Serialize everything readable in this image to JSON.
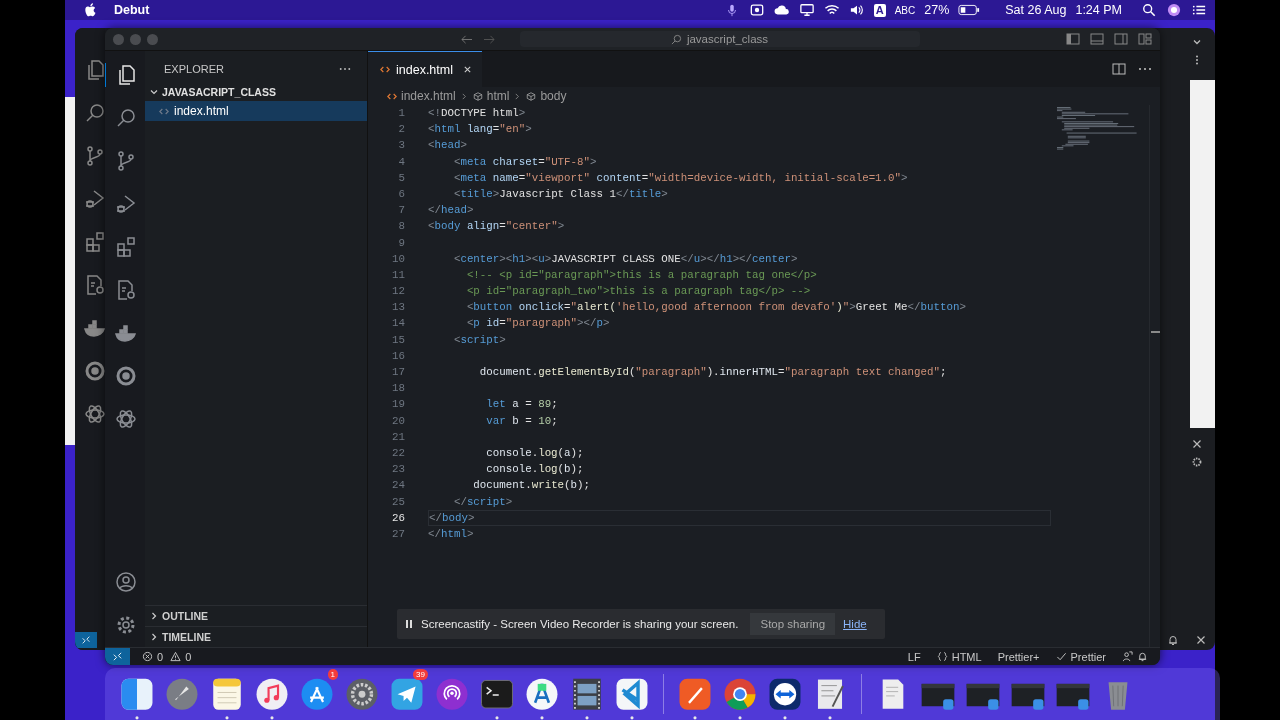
{
  "menubar": {
    "app_name": "Debut",
    "input_badge": "A",
    "input_source": "ABC",
    "battery": "27%",
    "date": "Sat 26 Aug",
    "time": "1:24 PM"
  },
  "editor_window": {
    "title_search": "javascript_class",
    "activity_bar": [
      {
        "kind": "files",
        "selected": true
      },
      {
        "kind": "search",
        "selected": false
      },
      {
        "kind": "branch",
        "selected": false
      },
      {
        "kind": "debug",
        "selected": false
      },
      {
        "kind": "extensions",
        "selected": false
      },
      {
        "kind": "doc-gear",
        "selected": false
      },
      {
        "kind": "docker",
        "selected": false
      },
      {
        "kind": "ring",
        "selected": false
      },
      {
        "kind": "knot",
        "selected": false
      }
    ],
    "activity_bottom": [
      {
        "kind": "account"
      },
      {
        "kind": "gear"
      }
    ],
    "sidebar": {
      "title": "EXPLORER",
      "folder": {
        "name": "JAVASACRIPT_CLASS",
        "expanded": true,
        "files": [
          {
            "name": "index.html",
            "selected": true
          }
        ]
      },
      "sections": [
        {
          "title": "OUTLINE",
          "expanded": false
        },
        {
          "title": "TIMELINE",
          "expanded": false
        }
      ]
    },
    "tabs": [
      {
        "label": "index.html",
        "selected": true
      }
    ],
    "breadcrumbs": [
      {
        "kind": "file",
        "label": "index.html"
      },
      {
        "kind": "element",
        "label": "html"
      },
      {
        "kind": "element",
        "label": "body"
      }
    ],
    "code_lines": [
      {
        "number": "1",
        "current": false,
        "tokens": [
          {
            "kind": "punct",
            "text": "<!"
          },
          {
            "kind": "text",
            "text": "DOCTYPE html"
          },
          {
            "kind": "punct",
            "text": ">"
          }
        ]
      },
      {
        "number": "2",
        "current": false,
        "tokens": [
          {
            "kind": "punct",
            "text": "<"
          },
          {
            "kind": "tag",
            "text": "html"
          },
          {
            "kind": "attr",
            "text": " lang"
          },
          {
            "kind": "text",
            "text": "="
          },
          {
            "kind": "string",
            "text": "\"en\""
          },
          {
            "kind": "punct",
            "text": ">"
          }
        ]
      },
      {
        "number": "3",
        "current": false,
        "tokens": [
          {
            "kind": "punct",
            "text": "<"
          },
          {
            "kind": "tag",
            "text": "head"
          },
          {
            "kind": "punct",
            "text": ">"
          }
        ]
      },
      {
        "number": "4",
        "current": false,
        "tokens": [
          {
            "kind": "punct",
            "text": "    <"
          },
          {
            "kind": "tag",
            "text": "meta"
          },
          {
            "kind": "attr",
            "text": " charset"
          },
          {
            "kind": "text",
            "text": "="
          },
          {
            "kind": "string",
            "text": "\"UTF-8\""
          },
          {
            "kind": "punct",
            "text": ">"
          }
        ]
      },
      {
        "number": "5",
        "current": false,
        "tokens": [
          {
            "kind": "punct",
            "text": "    <"
          },
          {
            "kind": "tag",
            "text": "meta"
          },
          {
            "kind": "attr",
            "text": " name"
          },
          {
            "kind": "text",
            "text": "="
          },
          {
            "kind": "string",
            "text": "\"viewport\""
          },
          {
            "kind": "attr",
            "text": " content"
          },
          {
            "kind": "text",
            "text": "="
          },
          {
            "kind": "string",
            "text": "\"width=device-width, initial-scale=1.0\""
          },
          {
            "kind": "punct",
            "text": ">"
          }
        ]
      },
      {
        "number": "6",
        "current": false,
        "tokens": [
          {
            "kind": "punct",
            "text": "    <"
          },
          {
            "kind": "tag",
            "text": "title"
          },
          {
            "kind": "punct",
            "text": ">"
          },
          {
            "kind": "text",
            "text": "Javascript Class 1"
          },
          {
            "kind": "punct",
            "text": "</"
          },
          {
            "kind": "tag",
            "text": "title"
          },
          {
            "kind": "punct",
            "text": ">"
          }
        ]
      },
      {
        "number": "7",
        "current": false,
        "tokens": [
          {
            "kind": "punct",
            "text": "</"
          },
          {
            "kind": "tag",
            "text": "head"
          },
          {
            "kind": "punct",
            "text": ">"
          }
        ]
      },
      {
        "number": "8",
        "current": false,
        "tokens": [
          {
            "kind": "punct",
            "text": "<"
          },
          {
            "kind": "tag",
            "text": "body"
          },
          {
            "kind": "attr",
            "text": " align"
          },
          {
            "kind": "text",
            "text": "="
          },
          {
            "kind": "string",
            "text": "\"center\""
          },
          {
            "kind": "punct",
            "text": ">"
          }
        ]
      },
      {
        "number": "9",
        "current": false
      },
      {
        "number": "10",
        "current": false,
        "tokens": [
          {
            "kind": "punct",
            "text": "    <"
          },
          {
            "kind": "tag",
            "text": "center"
          },
          {
            "kind": "punct",
            "text": "><"
          },
          {
            "kind": "tag",
            "text": "h1"
          },
          {
            "kind": "punct",
            "text": "><"
          },
          {
            "kind": "tag",
            "text": "u"
          },
          {
            "kind": "punct",
            "text": ">"
          },
          {
            "kind": "text",
            "text": "JAVASCRIPT CLASS ONE"
          },
          {
            "kind": "punct",
            "text": "</"
          },
          {
            "kind": "tag",
            "text": "u"
          },
          {
            "kind": "punct",
            "text": "></"
          },
          {
            "kind": "tag",
            "text": "h1"
          },
          {
            "kind": "punct",
            "text": "></"
          },
          {
            "kind": "tag",
            "text": "center"
          },
          {
            "kind": "punct",
            "text": ">"
          }
        ]
      },
      {
        "number": "11",
        "current": false,
        "tokens": [
          {
            "kind": "comment",
            "text": "      <!-- <p id=\"paragraph\">this is a paragraph tag one</p>"
          }
        ]
      },
      {
        "number": "12",
        "current": false,
        "tokens": [
          {
            "kind": "comment",
            "text": "      <p id=\"paragraph_two\">this is a paragraph tag</p> -->"
          }
        ]
      },
      {
        "number": "13",
        "current": false,
        "tokens": [
          {
            "kind": "punct",
            "text": "      <"
          },
          {
            "kind": "tag",
            "text": "button"
          },
          {
            "kind": "attr",
            "text": " onclick"
          },
          {
            "kind": "text",
            "text": "="
          },
          {
            "kind": "string",
            "text": "\""
          },
          {
            "kind": "function",
            "text": "alert("
          },
          {
            "kind": "string",
            "text": "'hello,good afternoon from devafo'"
          },
          {
            "kind": "function",
            "text": ")"
          },
          {
            "kind": "string",
            "text": "\""
          },
          {
            "kind": "punct",
            "text": ">"
          },
          {
            "kind": "text",
            "text": "Greet Me"
          },
          {
            "kind": "punct",
            "text": "</"
          },
          {
            "kind": "tag",
            "text": "button"
          },
          {
            "kind": "punct",
            "text": ">"
          }
        ]
      },
      {
        "number": "14",
        "current": false,
        "tokens": [
          {
            "kind": "punct",
            "text": "      <"
          },
          {
            "kind": "tag",
            "text": "p"
          },
          {
            "kind": "attr",
            "text": " id"
          },
          {
            "kind": "text",
            "text": "="
          },
          {
            "kind": "string",
            "text": "\"paragraph\""
          },
          {
            "kind": "punct",
            "text": "></"
          },
          {
            "kind": "tag",
            "text": "p"
          },
          {
            "kind": "punct",
            "text": ">"
          }
        ]
      },
      {
        "number": "15",
        "current": false,
        "tokens": [
          {
            "kind": "punct",
            "text": "    <"
          },
          {
            "kind": "tag",
            "text": "script"
          },
          {
            "kind": "punct",
            "text": ">"
          }
        ]
      },
      {
        "number": "16",
        "current": false
      },
      {
        "number": "17",
        "current": false,
        "tokens": [
          {
            "kind": "variable",
            "text": "        document"
          },
          {
            "kind": "text",
            "text": "."
          },
          {
            "kind": "function",
            "text": "getElementById"
          },
          {
            "kind": "text",
            "text": "("
          },
          {
            "kind": "string",
            "text": "\"paragraph\""
          },
          {
            "kind": "text",
            "text": ")."
          },
          {
            "kind": "variable",
            "text": "innerHTML"
          },
          {
            "kind": "text",
            "text": "="
          },
          {
            "kind": "string",
            "text": "\"paragraph text changed\""
          },
          {
            "kind": "text",
            "text": ";"
          }
        ]
      },
      {
        "number": "18",
        "current": false
      },
      {
        "number": "19",
        "current": false,
        "tokens": [
          {
            "kind": "keyword",
            "text": "         let"
          },
          {
            "kind": "variable",
            "text": " a"
          },
          {
            "kind": "text",
            "text": " = "
          },
          {
            "kind": "number",
            "text": "89"
          },
          {
            "kind": "text",
            "text": ";"
          }
        ]
      },
      {
        "number": "20",
        "current": false,
        "tokens": [
          {
            "kind": "keyword",
            "text": "         var"
          },
          {
            "kind": "variable",
            "text": " b"
          },
          {
            "kind": "text",
            "text": " = "
          },
          {
            "kind": "number",
            "text": "10"
          },
          {
            "kind": "text",
            "text": ";"
          }
        ]
      },
      {
        "number": "21",
        "current": false
      },
      {
        "number": "22",
        "current": false,
        "tokens": [
          {
            "kind": "variable",
            "text": "         console"
          },
          {
            "kind": "text",
            "text": "."
          },
          {
            "kind": "function",
            "text": "log"
          },
          {
            "kind": "text",
            "text": "("
          },
          {
            "kind": "variable",
            "text": "a"
          },
          {
            "kind": "text",
            "text": ");"
          }
        ]
      },
      {
        "number": "23",
        "current": false,
        "tokens": [
          {
            "kind": "variable",
            "text": "         console"
          },
          {
            "kind": "text",
            "text": "."
          },
          {
            "kind": "function",
            "text": "log"
          },
          {
            "kind": "text",
            "text": "("
          },
          {
            "kind": "variable",
            "text": "b"
          },
          {
            "kind": "text",
            "text": ");"
          }
        ]
      },
      {
        "number": "24",
        "current": false,
        "tokens": [
          {
            "kind": "variable",
            "text": "       document"
          },
          {
            "kind": "text",
            "text": "."
          },
          {
            "kind": "function",
            "text": "write"
          },
          {
            "kind": "text",
            "text": "("
          },
          {
            "kind": "variable",
            "text": "b"
          },
          {
            "kind": "text",
            "text": ");"
          }
        ]
      },
      {
        "number": "25",
        "current": false,
        "tokens": [
          {
            "kind": "punct",
            "text": "    </"
          },
          {
            "kind": "tag",
            "text": "script"
          },
          {
            "kind": "punct",
            "text": ">"
          }
        ]
      },
      {
        "number": "26",
        "current": true,
        "tokens": [
          {
            "kind": "punct",
            "text": "</"
          },
          {
            "kind": "tag",
            "text": "body"
          },
          {
            "kind": "punct",
            "text": ">"
          }
        ]
      },
      {
        "number": "27",
        "current": false,
        "tokens": [
          {
            "kind": "punct",
            "text": "</"
          },
          {
            "kind": "tag",
            "text": "html"
          },
          {
            "kind": "punct",
            "text": ">"
          }
        ]
      }
    ],
    "status_bar": {
      "errors": "0",
      "warnings": "0",
      "items": [
        {
          "kind": "eol",
          "label": "LF"
        },
        {
          "kind": "language",
          "label": "HTML"
        },
        {
          "kind": "formatter",
          "label": "Prettier+"
        },
        {
          "kind": "check",
          "label": "Prettier"
        }
      ]
    }
  },
  "sharing_bar": {
    "message": "Screencastify - Screen Video Recorder is sharing your screen.",
    "stop_button": "Stop sharing",
    "hide_link": "Hide"
  },
  "dock": [
    {
      "kind": "finder",
      "running": true
    },
    {
      "kind": "rocket",
      "running": false
    },
    {
      "kind": "notes",
      "running": true
    },
    {
      "kind": "music",
      "running": true
    },
    {
      "kind": "store",
      "running": false,
      "badge": "1"
    },
    {
      "kind": "settings",
      "running": false
    },
    {
      "kind": "plane",
      "running": false,
      "badge": "39"
    },
    {
      "kind": "podcast",
      "running": false
    },
    {
      "kind": "terminal",
      "running": true
    },
    {
      "kind": "compass",
      "running": true
    },
    {
      "kind": "film",
      "running": true
    },
    {
      "kind": "code",
      "running": true
    },
    {
      "kind": "separator"
    },
    {
      "kind": "orange-pen",
      "running": true
    },
    {
      "kind": "browser",
      "running": true
    },
    {
      "kind": "arrows",
      "running": true
    },
    {
      "kind": "script",
      "running": true
    },
    {
      "kind": "separator"
    },
    {
      "kind": "document",
      "running": false
    },
    {
      "kind": "thumbnail",
      "running": false
    },
    {
      "kind": "thumbnail",
      "running": false
    },
    {
      "kind": "thumbnail",
      "running": false
    },
    {
      "kind": "thumbnail",
      "running": false
    },
    {
      "kind": "trash",
      "running": false
    }
  ]
}
